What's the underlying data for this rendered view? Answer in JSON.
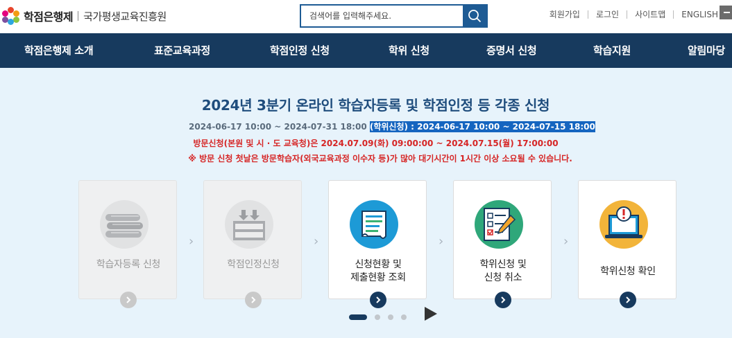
{
  "header": {
    "logo_main": "학점은행제",
    "logo_sub": "국가평생교육진흥원",
    "search_placeholder": "검색어를 입력해주세요.",
    "util_links": [
      "회원가입",
      "로그인",
      "사이트맵",
      "ENGLISH"
    ]
  },
  "nav": {
    "items": [
      "학점은행제 소개",
      "표준교육과정",
      "학점인정 신청",
      "학위 신청",
      "증명서 신청",
      "학습지원",
      "알림마당"
    ]
  },
  "notice": {
    "title": "2024년 3분기 온라인 학습자등록 및 학점인정 등 각종 신청",
    "period": "2024-06-17 10:00 ~ 2024-07-31 18:00 ",
    "degree_period": "(학위신청) : 2024-06-17 10:00 ~ 2024-07-15 18:00",
    "visit": "방문신청(본원 및 시 · 도 교육청)은 2024.07.09(화) 09:00:00 ~ 2024.07.15(월) 17:00:00",
    "warning": "※ 방문 신청 첫날은 방문학습자(외국교육과정 이수자 등)가 많아 대기시간이 1시간 이상 소요될 수 있습니다."
  },
  "cards": [
    {
      "line1": "학습자등록 신청",
      "line2": "",
      "icon": "books-icon",
      "disabled": true
    },
    {
      "line1": "학점인정신청",
      "line2": "",
      "icon": "inbox-tray-icon",
      "disabled": true
    },
    {
      "line1": "신청현황 및",
      "line2": "제출현황 조회",
      "icon": "document-scroll-icon",
      "disabled": false
    },
    {
      "line1": "학위신청 및",
      "line2": "신청 취소",
      "icon": "checklist-pencil-icon",
      "disabled": false
    },
    {
      "line1": "학위신청 확인",
      "line2": "",
      "icon": "laptop-alert-icon",
      "disabled": false
    }
  ],
  "slider": {
    "active_index": 0,
    "count": 4
  },
  "colors": {
    "nav_bg": "#173a5e",
    "main_bg": "#e7f3fb",
    "title": "#1f4d7d",
    "alert": "#d62525",
    "highlight": "#1565c0"
  }
}
